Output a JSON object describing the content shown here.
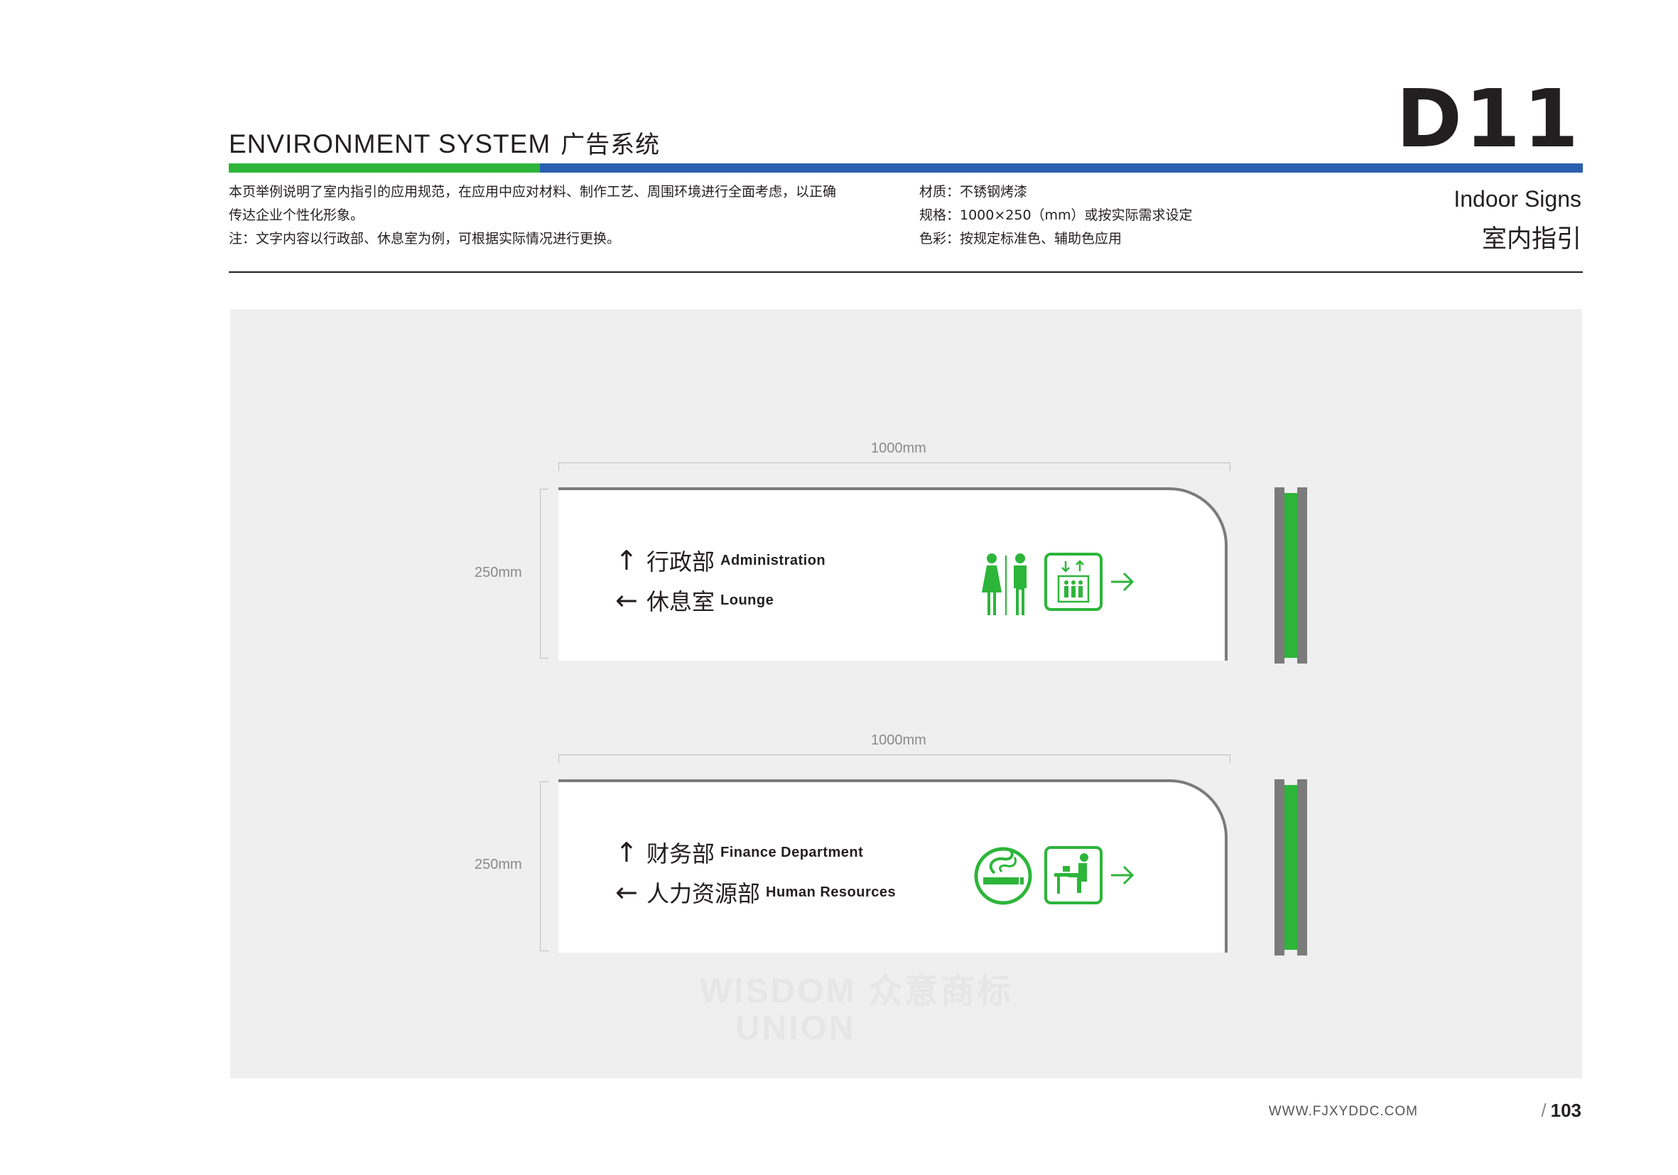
{
  "header": {
    "title_en": "ENVIRONMENT SYSTEM",
    "title_cn": "广告系统",
    "code": "D11",
    "section_en": "Indoor Signs",
    "section_cn": "室内指引",
    "colors": {
      "green": "#2db53a",
      "blue": "#2b5faf"
    }
  },
  "description": {
    "line1": "本页举例说明了室内指引的应用规范，在应用中应对材料、制作工艺、周围环境进行全面考虑，以正确",
    "line2": "传达企业个性化形象。",
    "line3": "注：文字内容以行政部、休息室为例，可根据实际情况进行更换。"
  },
  "specs": {
    "material": "材质：不锈钢烤漆",
    "size": "规格：1000×250（mm）或按实际需求设定",
    "color": "色彩：按规定标准色、辅助色应用"
  },
  "signs": [
    {
      "width_label": "1000mm",
      "height_label": "250mm",
      "rows": [
        {
          "arrow": "↑",
          "cn": "行政部",
          "en": "Administration"
        },
        {
          "arrow": "←",
          "cn": "休息室",
          "en": "Lounge"
        }
      ],
      "icons": [
        "restroom-icon",
        "elevator-icon",
        "arrow-right-icon"
      ]
    },
    {
      "width_label": "1000mm",
      "height_label": "250mm",
      "rows": [
        {
          "arrow": "↑",
          "cn": "财务部",
          "en": "Finance Department"
        },
        {
          "arrow": "←",
          "cn": "人力资源部",
          "en": "Human Resources"
        }
      ],
      "icons": [
        "smoking-area-icon",
        "rest-area-icon",
        "arrow-right-icon"
      ]
    }
  ],
  "watermark": {
    "line1": "WISDOM 众意商标",
    "line2": "UNION"
  },
  "footer": {
    "url": "WWW.FJXYDDC.COM",
    "page": "103",
    "slash": "/"
  }
}
